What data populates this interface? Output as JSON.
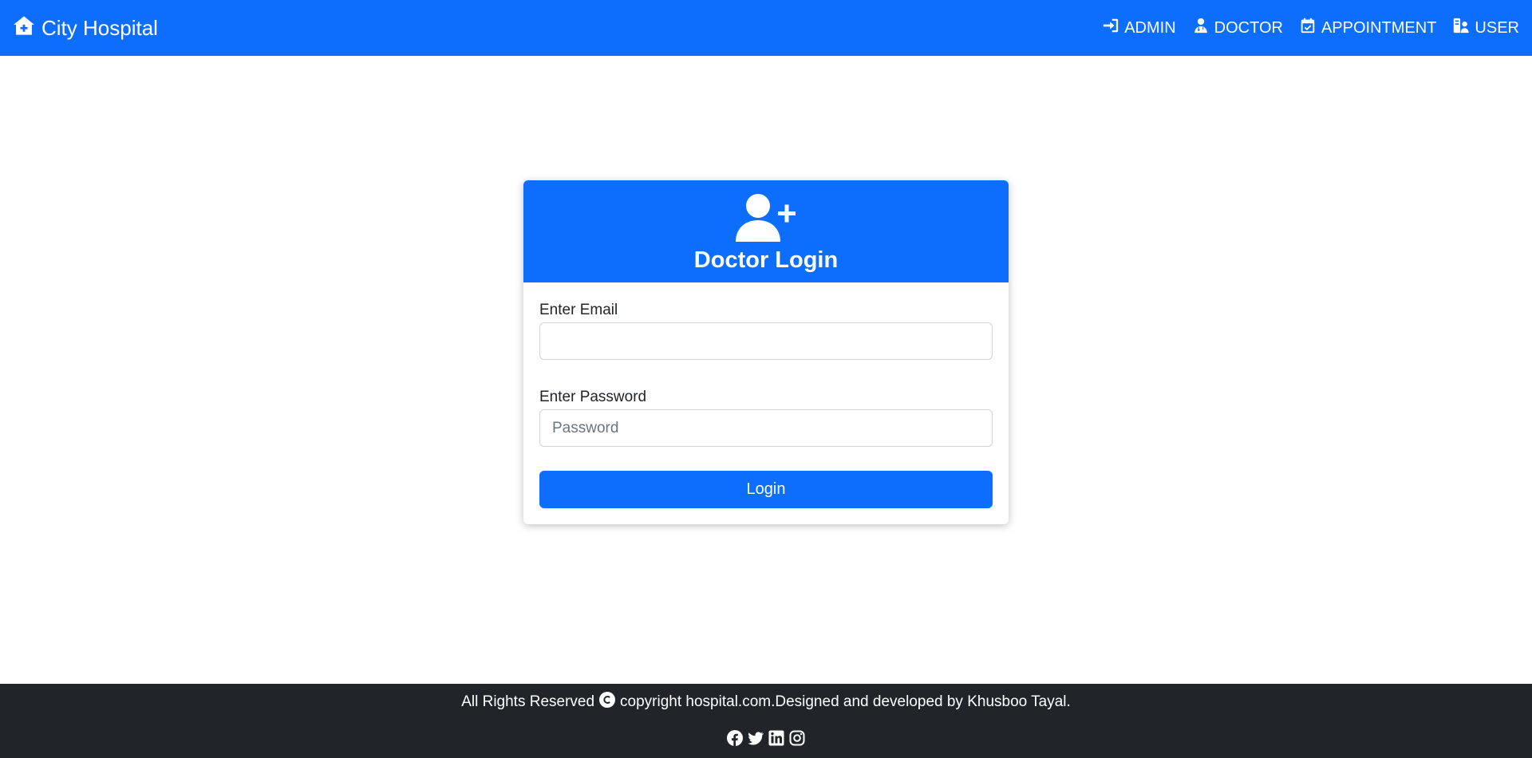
{
  "brand": {
    "name": "City Hospital",
    "icon": "house-medical-icon"
  },
  "nav": {
    "items": [
      {
        "label": "ADMIN",
        "icon": "sign-in-icon"
      },
      {
        "label": "DOCTOR",
        "icon": "doctor-icon"
      },
      {
        "label": "APPOINTMENT",
        "icon": "calendar-check-icon"
      },
      {
        "label": "USER",
        "icon": "user-id-icon"
      }
    ]
  },
  "login": {
    "title": "Doctor Login",
    "icon": "user-plus-icon",
    "email_label": "Enter Email",
    "email_value": "",
    "email_placeholder": "",
    "password_label": "Enter Password",
    "password_value": "",
    "password_placeholder": "Password",
    "submit_label": "Login"
  },
  "footer": {
    "text_prefix": "All Rights Reserved",
    "text_suffix": "copyright hospital.com.Designed and developed by Khusboo Tayal.",
    "social_icons": [
      "facebook-icon",
      "twitter-icon",
      "linkedin-icon",
      "instagram-icon"
    ]
  },
  "colors": {
    "primary": "#0d6efd",
    "footer_bg": "#212529",
    "border": "#ced4da"
  }
}
